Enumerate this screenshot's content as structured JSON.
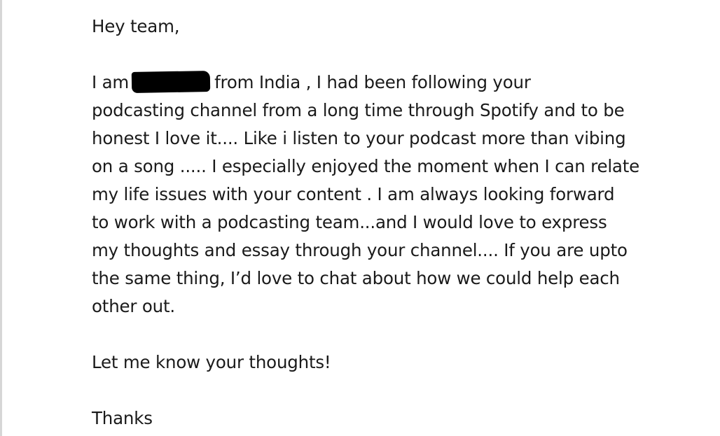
{
  "email": {
    "greeting": "Hey team,",
    "intro_before": "I am",
    "intro_after": "from India , I had been following your",
    "body_lines": [
      "podcasting channel from a long time through Spotify and to be",
      "honest I love it.... Like i listen to your podcast more than vibing",
      "on a song ..... I especially enjoyed the moment when I can relate",
      "my life issues with your content . I am always looking forward",
      "to work with a podcasting team...and I would love to express",
      "my thoughts and essay through your channel.... If you are upto",
      "the same thing, I’d love to chat about how we could help each",
      "other out."
    ],
    "closing_request": "Let me know your thoughts!",
    "signoff": "Thanks"
  }
}
